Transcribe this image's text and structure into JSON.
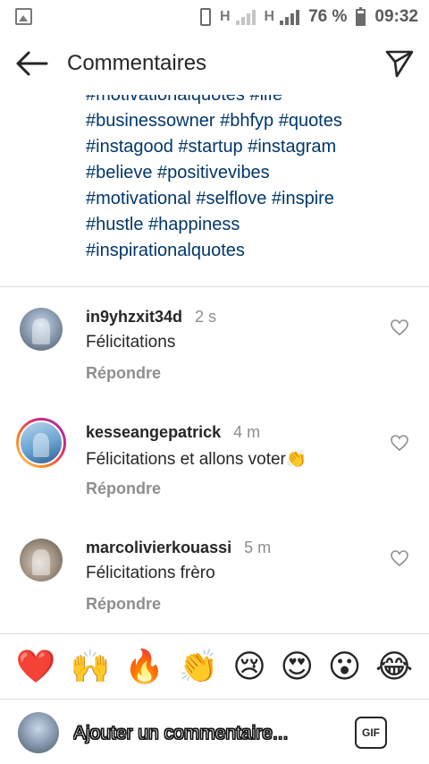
{
  "status_bar": {
    "network_1": "H",
    "network_2": "H",
    "battery": "76 %",
    "time": "09:32"
  },
  "header": {
    "title": "Commentaires"
  },
  "caption": {
    "lines": [
      "#motivationalquotes #life",
      "#businessowner #bhfyp #quotes",
      "#instagood #startup #instagram",
      "#believe #positivevibes",
      "#motivational #selflove #inspire",
      "#hustle #happiness",
      "#inspirationalquotes"
    ]
  },
  "comments": [
    {
      "username": "in9yhzxit34d",
      "time": "2 s",
      "text": "Félicitations",
      "reply_label": "Répondre"
    },
    {
      "username": "kesseangepatrick",
      "time": "4 m",
      "text": "Félicitations et allons voter👏",
      "reply_label": "Répondre"
    },
    {
      "username": "marcolivierkouassi",
      "time": "5 m",
      "text": "Félicitations frèro",
      "reply_label": "Répondre"
    }
  ],
  "emoji_bar": [
    "❤️",
    "🙌",
    "🔥",
    "👏",
    "😢",
    "😍",
    "😮",
    "😂"
  ],
  "composer": {
    "placeholder": "Ajouter un commentaire...",
    "gif_label": "GIF"
  },
  "colors": {
    "hashtag": "#00376b",
    "secondary_text": "#8e8e8e",
    "divider": "#dbdbdb"
  }
}
